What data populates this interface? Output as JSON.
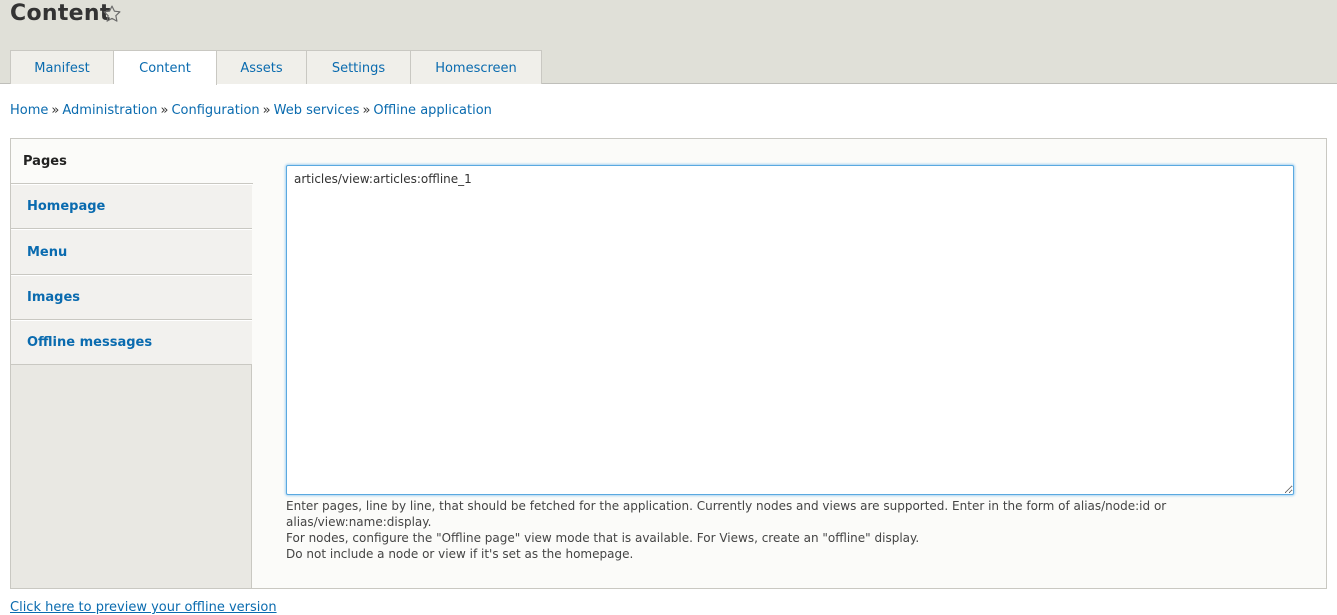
{
  "page": {
    "title": "Content"
  },
  "tabs": [
    {
      "label": "Manifest",
      "active": false
    },
    {
      "label": "Content",
      "active": true
    },
    {
      "label": "Assets",
      "active": false
    },
    {
      "label": "Settings",
      "active": false
    },
    {
      "label": "Homescreen",
      "active": false
    }
  ],
  "breadcrumb": {
    "items": [
      "Home",
      "Administration",
      "Configuration",
      "Web services",
      "Offline application"
    ],
    "separator": "»"
  },
  "vertical_tabs": [
    {
      "label": "Pages",
      "active": true
    },
    {
      "label": "Homepage",
      "active": false
    },
    {
      "label": "Menu",
      "active": false
    },
    {
      "label": "Images",
      "active": false
    },
    {
      "label": "Offline messages",
      "active": false
    }
  ],
  "pages_field": {
    "value": "articles/view:articles:offline_1",
    "description": [
      "Enter pages, line by line, that should be fetched for the application. Currently nodes and views are supported. Enter in the form of alias/node:id or alias/view:name:display.",
      "For nodes, configure the \"Offline page\" view mode that is available. For Views, create an \"offline\" display.",
      "Do not include a node or view if it's set as the homepage."
    ]
  },
  "preview_link": "Click here to preview your offline version",
  "icons": {
    "favorite": "star-outline-icon"
  },
  "colors": {
    "link": "#0a6baf",
    "header_bg": "#e0e0d8",
    "focus_border": "#5aa9e0"
  }
}
